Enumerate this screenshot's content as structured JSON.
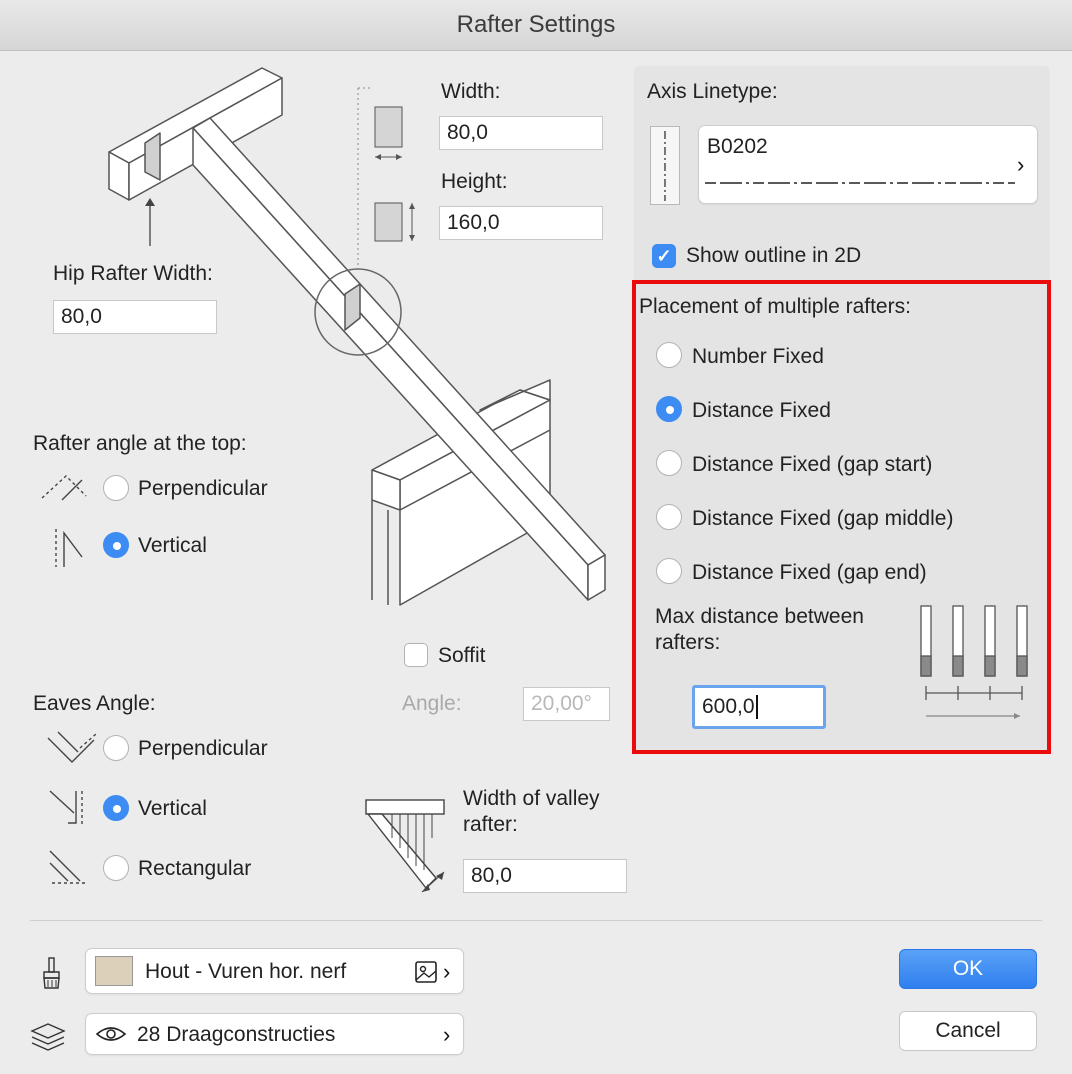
{
  "window": {
    "title": "Rafter Settings"
  },
  "top_dims": {
    "width_label": "Width:",
    "width_value": "80,0",
    "height_label": "Height:",
    "height_value": "160,0"
  },
  "hip": {
    "label": "Hip Rafter Width:",
    "value": "80,0"
  },
  "rafter_angle": {
    "label": "Rafter angle at the top:",
    "options": [
      {
        "label": "Perpendicular",
        "selected": false
      },
      {
        "label": "Vertical",
        "selected": true
      }
    ]
  },
  "soffit": {
    "label": "Soffit",
    "checked": false,
    "angle_label": "Angle:",
    "angle_value": "20,00°"
  },
  "eaves": {
    "label": "Eaves Angle:",
    "options": [
      {
        "label": "Perpendicular",
        "selected": false
      },
      {
        "label": "Vertical",
        "selected": true
      },
      {
        "label": "Rectangular",
        "selected": false
      }
    ]
  },
  "valley": {
    "label_line1": "Width of valley",
    "label_line2": "rafter:",
    "value": "80,0"
  },
  "axis": {
    "label": "Axis Linetype:",
    "linetype_name": "B0202",
    "outline_label": "Show outline in 2D",
    "outline_checked": true
  },
  "placement": {
    "label": "Placement of multiple rafters:",
    "options": [
      {
        "label": "Number Fixed",
        "selected": false
      },
      {
        "label": "Distance Fixed",
        "selected": true
      },
      {
        "label": "Distance Fixed (gap start)",
        "selected": false
      },
      {
        "label": "Distance Fixed (gap middle)",
        "selected": false
      },
      {
        "label": "Distance Fixed (gap end)",
        "selected": false
      }
    ],
    "max_label_line1": "Max distance between",
    "max_label_line2": "rafters:",
    "max_value": "600,0"
  },
  "material": {
    "name": "Hout - Vuren hor. nerf",
    "swatch_color": "#ddd0bb"
  },
  "layer": {
    "name": "28 Draagconstructies"
  },
  "buttons": {
    "ok": "OK",
    "cancel": "Cancel"
  },
  "colors": {
    "accent": "#3d8cf3",
    "highlight": "#ea0c0c"
  }
}
